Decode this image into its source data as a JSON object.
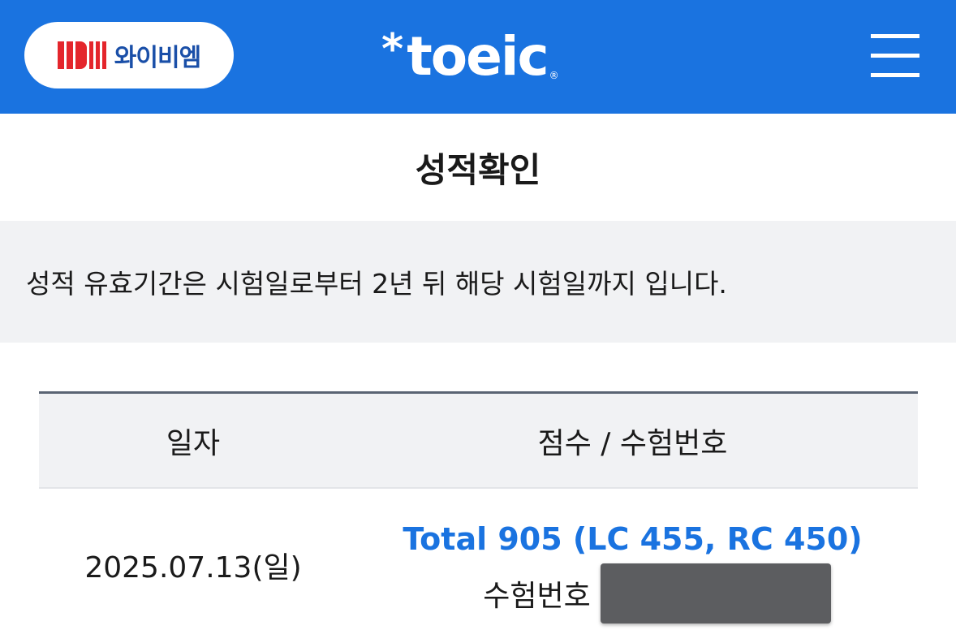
{
  "header": {
    "brand_text": "와이비엠",
    "logo_mark": "YBM",
    "toeic_star": "*",
    "toeic_word": "toeic",
    "toeic_registered": "®",
    "menu_icon": "hamburger-menu-icon",
    "bg_color": "#1a73e0"
  },
  "page": {
    "title": "성적확인"
  },
  "notice": {
    "text": "성적 유효기간은 시험일로부터 2년 뒤 해당 시험일까지 입니다."
  },
  "table": {
    "columns": [
      "일자",
      "점수 / 수험번호"
    ],
    "rows": [
      {
        "date": "2025.07.13(일)",
        "score": "Total 905 (LC 455, RC 450)",
        "exam_label": "수험번호",
        "exam_number_redacted": true
      }
    ]
  },
  "colors": {
    "accent": "#1a73e0",
    "brand_red": "#e4262c",
    "brand_blue": "#1a4fa8",
    "notice_bg": "#f1f2f4"
  }
}
